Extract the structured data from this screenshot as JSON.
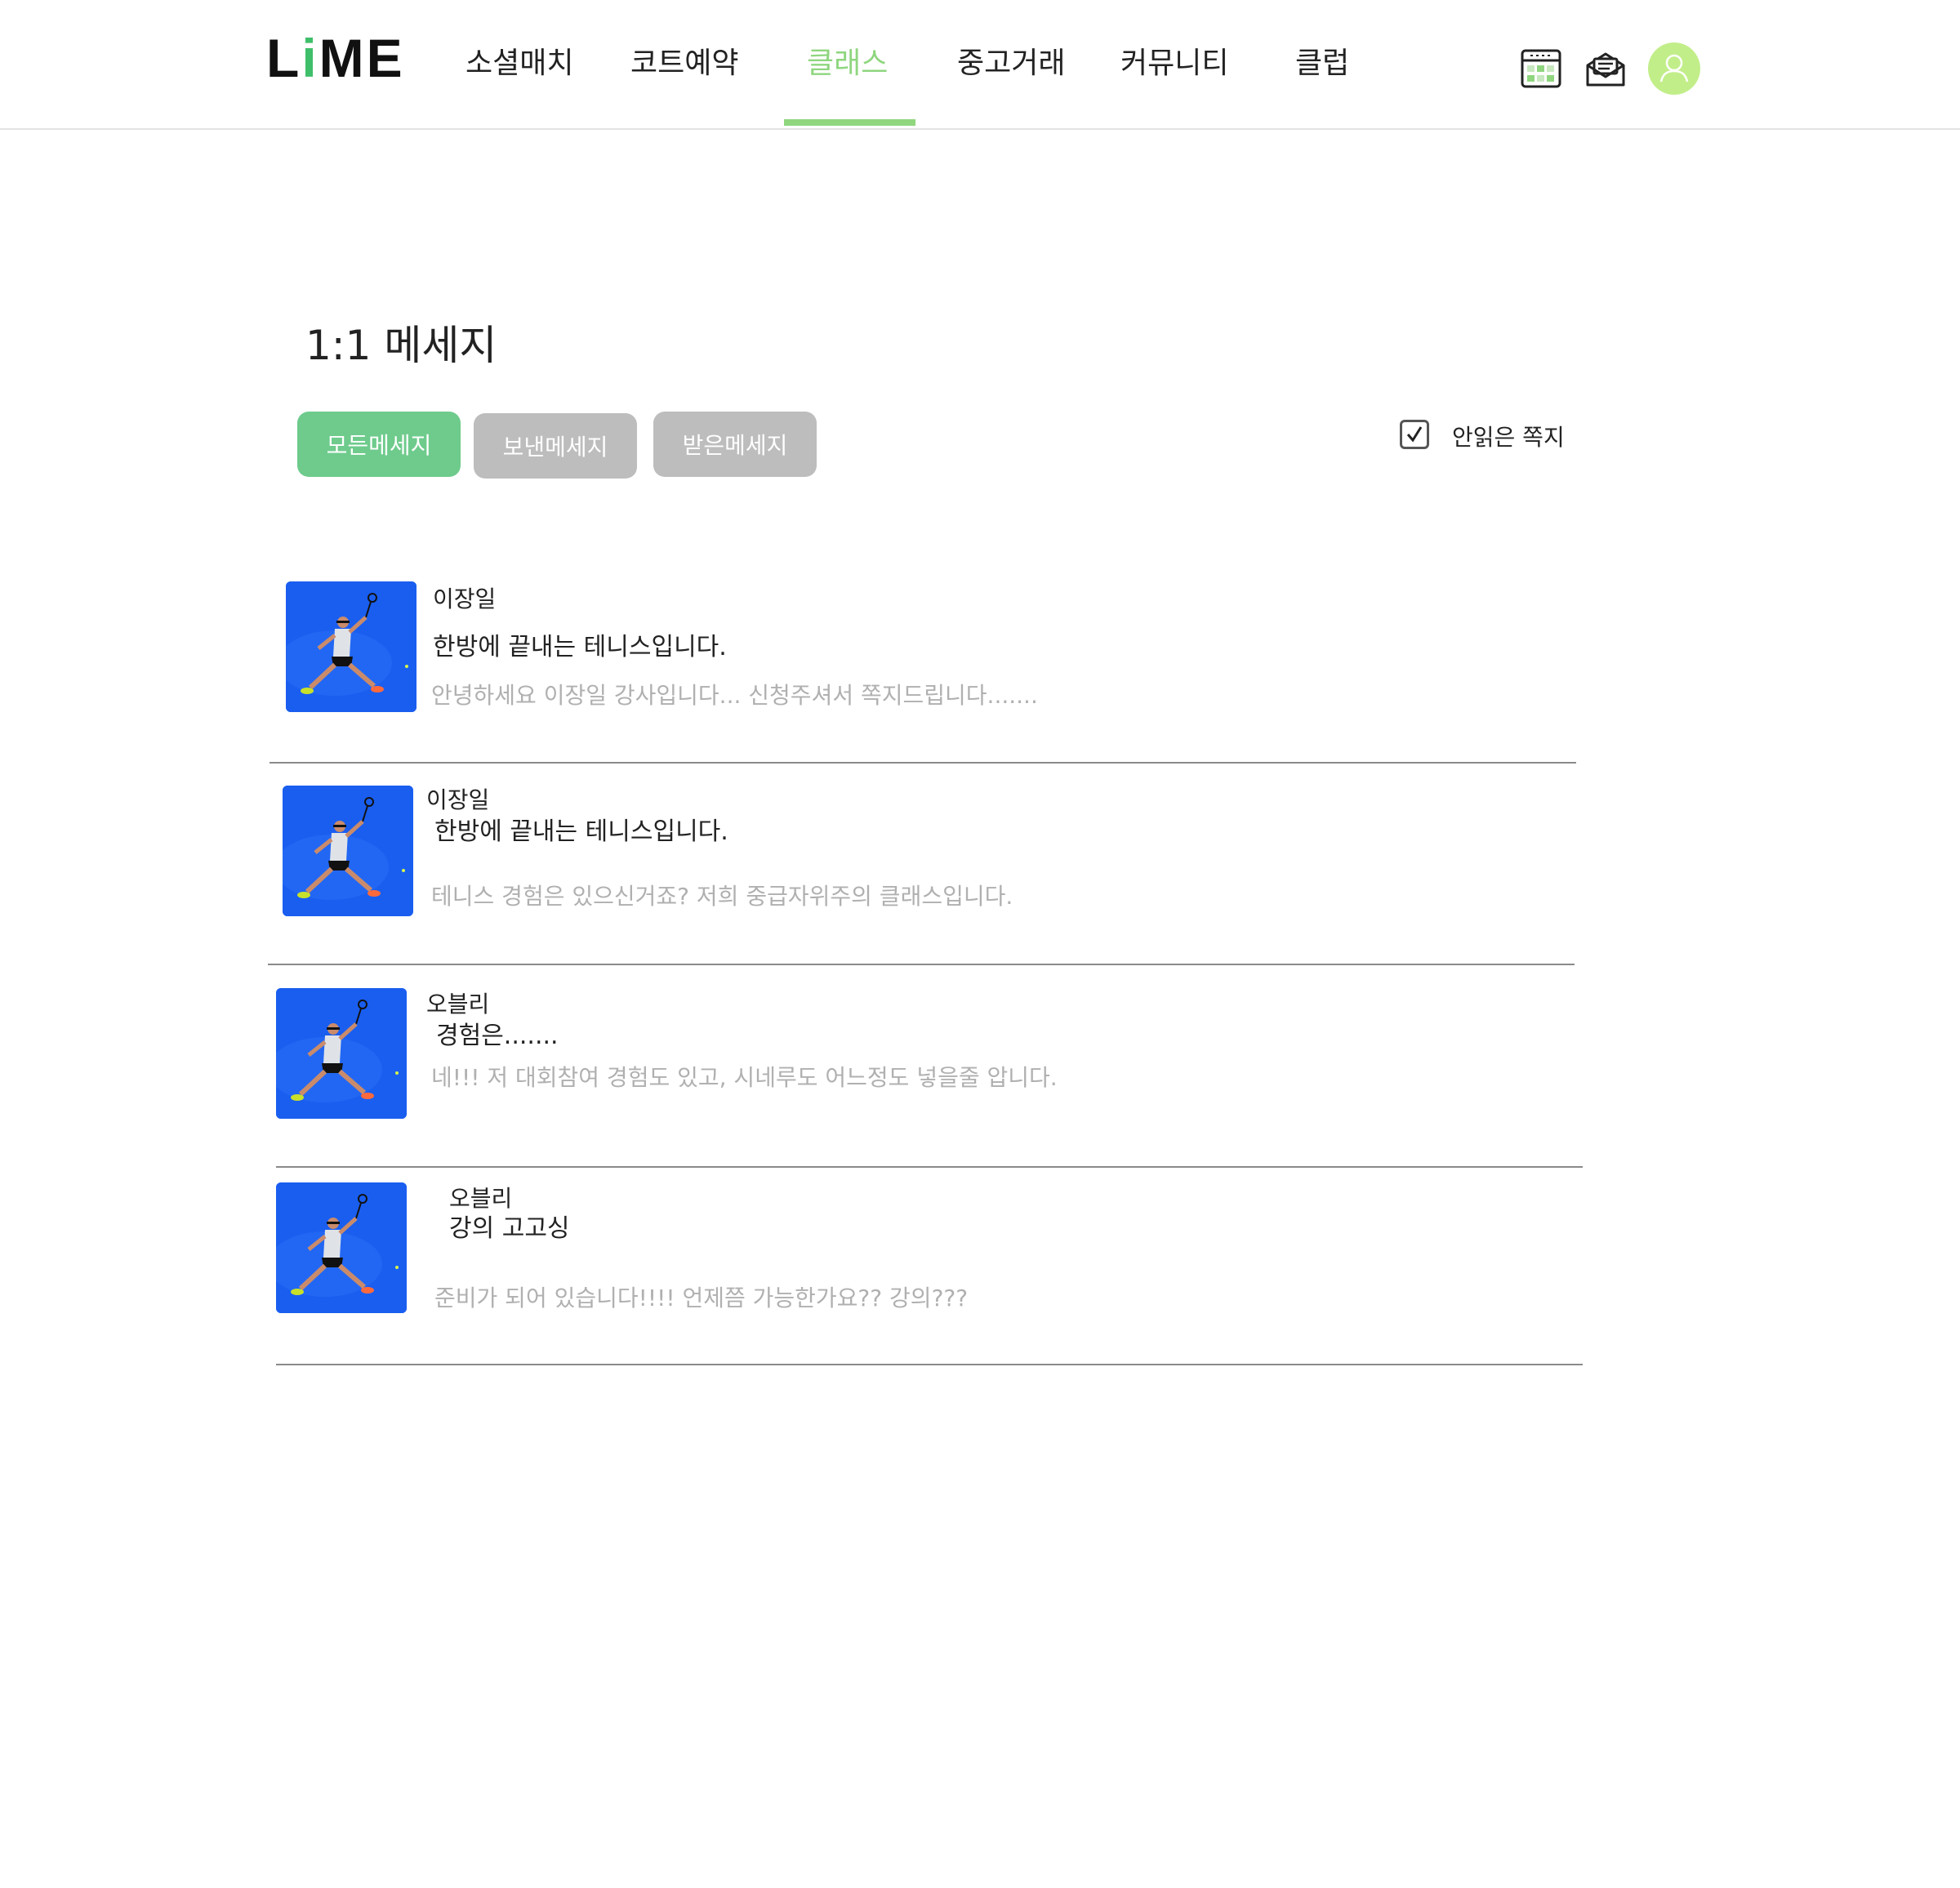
{
  "colors": {
    "accent": "#8fd67f",
    "logo_i": "#3fbf6a",
    "primary_button": "#6ecb8c",
    "inactive_button": "#bdbdbd",
    "avatar_bg": "#c2ee8a",
    "preview_text": "#b0b0b0"
  },
  "header": {
    "logo": {
      "prefix": "L",
      "highlight": "i",
      "suffix": "ME"
    },
    "nav": [
      {
        "label": "소셜매치",
        "active": false
      },
      {
        "label": "코트예약",
        "active": false
      },
      {
        "label": "클래스",
        "active": true
      },
      {
        "label": "중고거래",
        "active": false
      },
      {
        "label": "커뮤니티",
        "active": false
      },
      {
        "label": "클럽",
        "active": false
      }
    ],
    "icons": [
      "calendar-icon",
      "mail-icon",
      "user-avatar-icon"
    ]
  },
  "page": {
    "title": "1:1 메세지",
    "filters": [
      {
        "label": "모든메세지",
        "active": true
      },
      {
        "label": "보낸메세지",
        "active": false
      },
      {
        "label": "받은메세지",
        "active": false
      }
    ],
    "unread_filter": {
      "label": "안읽은 쪽지",
      "checked": true
    }
  },
  "messages": [
    {
      "sender": "이장일",
      "subject": "한방에 끝내는 테니스입니다.",
      "preview": "안녕하세요 이장일 강사입니다... 신청주셔서 쪽지드립니다......."
    },
    {
      "sender": "이장일",
      "subject": "한방에 끝내는 테니스입니다.",
      "preview": "테니스 경험은 있으신거죠? 저희 중급자위주의 클래스입니다."
    },
    {
      "sender": "오블리",
      "subject": "경험은.......",
      "preview": "네!!!  저 대회참여 경험도 있고,  시네루도 어느정도 넣을줄 압니다."
    },
    {
      "sender": "오블리",
      "subject": "강의 고고싱",
      "preview": "준비가 되어 있습니다!!!!   언제쯤 가능한가요?? 강의???"
    }
  ]
}
